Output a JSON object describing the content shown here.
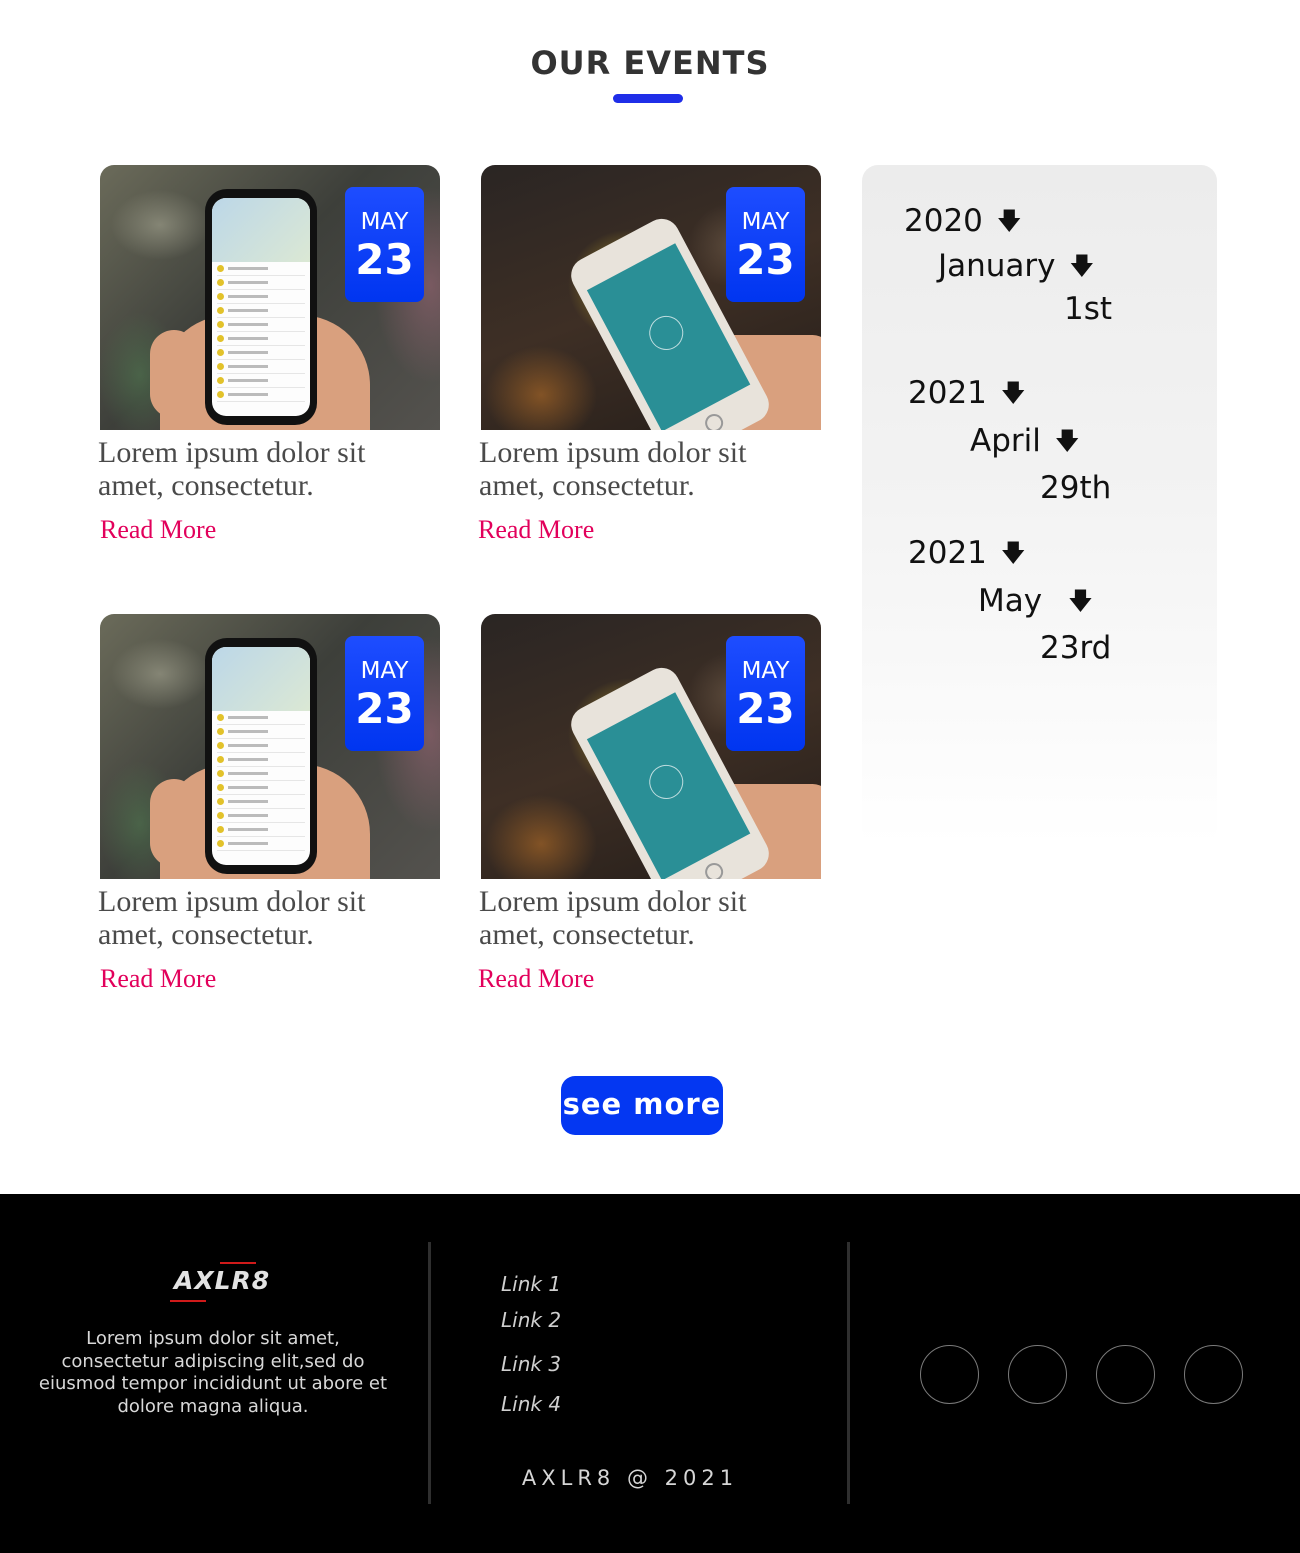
{
  "section": {
    "title": "OUR EVENTS"
  },
  "cards": [
    {
      "month": "MAY",
      "day": "23",
      "text": "Lorem ipsum dolor sit amet, consectetur.",
      "link": "Read More"
    },
    {
      "month": "MAY",
      "day": "23",
      "text": "Lorem ipsum dolor sit amet, consectetur.",
      "link": "Read More"
    },
    {
      "month": "MAY",
      "day": "23",
      "text": "Lorem ipsum dolor sit amet, consectetur.",
      "link": "Read More"
    },
    {
      "month": "MAY",
      "day": "23",
      "text": "Lorem ipsum dolor sit amet, consectetur.",
      "link": "Read More"
    }
  ],
  "timeline": [
    {
      "year": "2020",
      "month": "January",
      "day": "1st"
    },
    {
      "year": "2021",
      "month": "April",
      "day": "29th"
    },
    {
      "year": "2021",
      "month": "May",
      "day": "23rd"
    }
  ],
  "see_more": "see more",
  "footer": {
    "brand": "AXLR8",
    "description": "Lorem ipsum dolor sit amet, consectetur adipiscing elit,sed do eiusmod tempor incididunt ut abore et dolore magna aliqua.",
    "links": [
      "Link 1",
      "Link 2",
      "Link 3",
      "Link 4"
    ],
    "copyright": "AXLR8 @ 2021"
  },
  "colors": {
    "accent": "#0437f2",
    "link": "#e2005b",
    "footer_bg": "#000000",
    "brand_line": "#d01a1a"
  },
  "icons": {
    "timeline_arrow": "arrow-down-icon",
    "social": "social-icon-circle"
  }
}
